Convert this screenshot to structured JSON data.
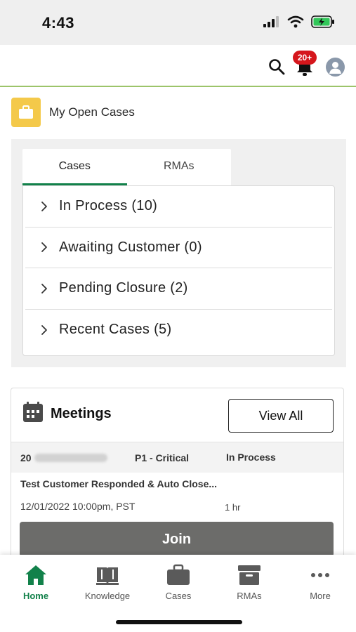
{
  "status_bar": {
    "time": "4:43"
  },
  "header": {
    "notification_badge": "20+",
    "icons": [
      "search-icon",
      "bell-icon",
      "avatar-icon"
    ],
    "accent_color": "#9cc46a"
  },
  "section": {
    "title": "My Open Cases",
    "icon": "briefcase-icon"
  },
  "cases": {
    "tabs": [
      {
        "label": "Cases",
        "active": true
      },
      {
        "label": "RMAs",
        "active": false
      }
    ],
    "items": [
      {
        "label": "In Process (10)"
      },
      {
        "label": "Awaiting Customer (0)"
      },
      {
        "label": "Pending Closure (2)"
      },
      {
        "label": "Recent Cases (5)"
      }
    ]
  },
  "meetings": {
    "title": "Meetings",
    "view_all_label": "View All",
    "item": {
      "id_prefix": "20",
      "priority": "P1 - Critical",
      "status": "In Process",
      "subject": "Test Customer Responded & Auto Close...",
      "datetime": "12/01/2022 10:00pm, PST",
      "duration": "1 hr",
      "join_label": "Join"
    }
  },
  "bottom_nav": {
    "items": [
      {
        "label": "Home",
        "icon": "home-icon",
        "active": true
      },
      {
        "label": "Knowledge",
        "icon": "book-icon",
        "active": false
      },
      {
        "label": "Cases",
        "icon": "briefcase-icon",
        "active": false
      },
      {
        "label": "RMAs",
        "icon": "archive-box-icon",
        "active": false
      },
      {
        "label": "More",
        "icon": "more-dots-icon",
        "active": false
      }
    ],
    "active_color": "#12814a"
  }
}
